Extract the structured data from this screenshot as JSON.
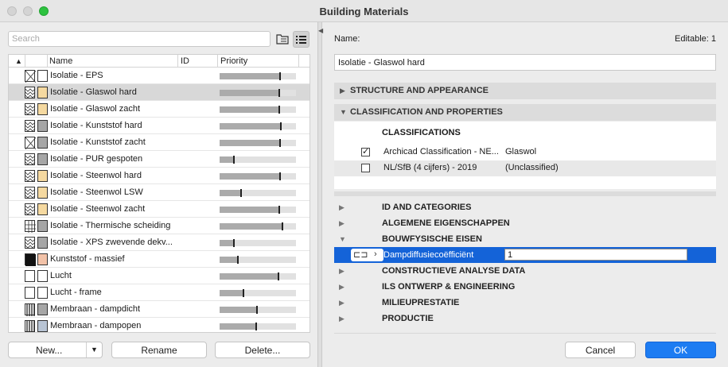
{
  "window": {
    "title": "Building Materials"
  },
  "search": {
    "placeholder": "Search"
  },
  "table": {
    "headers": {
      "name": "Name",
      "id": "ID",
      "priority": "Priority"
    },
    "rows": [
      {
        "name": "Isolatie - EPS",
        "pattern": "cross",
        "swatch": "#ffffff",
        "priority": 0.78,
        "selected": false
      },
      {
        "name": "Isolatie - Glaswol hard",
        "pattern": "zigzag",
        "swatch": "#f5d9a0",
        "priority": 0.77,
        "selected": true
      },
      {
        "name": "Isolatie - Glaswol zacht",
        "pattern": "zigzag",
        "swatch": "#f5d9a0",
        "priority": 0.77,
        "selected": false
      },
      {
        "name": "Isolatie - Kunststof hard",
        "pattern": "zigzag",
        "swatch": "#a6a6a6",
        "priority": 0.79,
        "selected": false
      },
      {
        "name": "Isolatie - Kunststof zacht",
        "pattern": "cross",
        "swatch": "#a6a6a6",
        "priority": 0.78,
        "selected": false
      },
      {
        "name": "Isolatie - PUR gespoten",
        "pattern": "zigzag",
        "swatch": "#a6a6a6",
        "priority": 0.18,
        "selected": false
      },
      {
        "name": "Isolatie - Steenwol hard",
        "pattern": "zigzag",
        "swatch": "#f5d9a0",
        "priority": 0.78,
        "selected": false
      },
      {
        "name": "Isolatie - Steenwol LSW",
        "pattern": "zigzag",
        "swatch": "#f5d9a0",
        "priority": 0.27,
        "selected": false
      },
      {
        "name": "Isolatie - Steenwol zacht",
        "pattern": "zigzag",
        "swatch": "#f5d9a0",
        "priority": 0.77,
        "selected": false
      },
      {
        "name": "Isolatie - Thermische scheiding",
        "pattern": "grid",
        "swatch": "#a6a6a6",
        "priority": 0.81,
        "selected": false
      },
      {
        "name": "Isolatie - XPS zwevende dekv...",
        "pattern": "zigzag",
        "swatch": "#a6a6a6",
        "priority": 0.18,
        "selected": false
      },
      {
        "name": "Kunststof - massief",
        "pattern": "solid",
        "swatch": "#f2c2a8",
        "priority": 0.23,
        "selected": false
      },
      {
        "name": "Lucht",
        "pattern": "empty",
        "swatch": "#ffffff",
        "priority": 0.76,
        "selected": false
      },
      {
        "name": "Lucht - frame",
        "pattern": "empty",
        "swatch": "#ffffff",
        "priority": 0.3,
        "selected": false
      },
      {
        "name": "Membraan - dampdicht",
        "pattern": "vlines",
        "swatch": "#a6a6a6",
        "priority": 0.48,
        "selected": false
      },
      {
        "name": "Membraan - dampopen",
        "pattern": "vlines",
        "swatch": "#b8c4d4",
        "priority": 0.47,
        "selected": false
      }
    ]
  },
  "buttons": {
    "new": "New...",
    "rename": "Rename",
    "delete": "Delete...",
    "cancel": "Cancel",
    "ok": "OK"
  },
  "details": {
    "name_label": "Name:",
    "editable": "Editable: 1",
    "name_value": "Isolatie - Glaswol hard",
    "sections": {
      "structure": "STRUCTURE AND APPEARANCE",
      "classification": "CLASSIFICATION AND PROPERTIES"
    },
    "classifications": {
      "header": "CLASSIFICATIONS",
      "items": [
        {
          "checked": true,
          "name": "Archicad Classification - NE...",
          "value": "Glaswol"
        },
        {
          "checked": false,
          "name": "NL/SfB (4 cijfers) - 2019",
          "value": "(Unclassified)"
        }
      ]
    },
    "properties": {
      "groups": [
        {
          "title": "ID AND CATEGORIES",
          "expanded": false
        },
        {
          "title": "ALGEMENE EIGENSCHAPPEN",
          "expanded": false
        },
        {
          "title": "BOUWFYSISCHE EISEN",
          "expanded": true
        }
      ],
      "active_property": {
        "name": "Dampdiffusiecoëfficiënt",
        "value": "1"
      },
      "groups_after": [
        {
          "title": "CONSTRUCTIEVE ANALYSE DATA",
          "expanded": false
        },
        {
          "title": "ILS ONTWERP & ENGINEERING",
          "expanded": false
        },
        {
          "title": "MILIEUPRESTATIE",
          "expanded": false
        },
        {
          "title": "PRODUCTIE",
          "expanded": false
        }
      ]
    }
  }
}
